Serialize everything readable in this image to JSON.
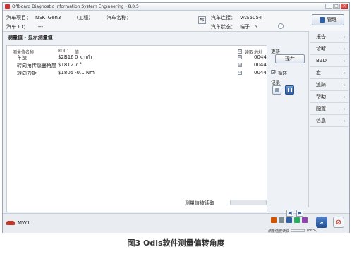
{
  "window": {
    "title": "Offboard Diagnostic Information System Engineering - 8.0.5",
    "controls": [
      "minimize-icon",
      "maximize-icon",
      "close-icon"
    ]
  },
  "info": {
    "project_label": "汽车项目：",
    "project_value": "NSK_Gen3",
    "project_note": "（工程）",
    "vehicle_name_label": "汽车名称：",
    "vehicle_id_label": "汽车 ID：",
    "vehicle_id_value": "---",
    "connection_label": "汽车连接：",
    "connection_value": "VAS5054",
    "state_label": "汽车状态：",
    "state_value": "端子 15",
    "manage_button": "管理"
  },
  "section_title": "测量值 - 显示测量值",
  "table": {
    "columns": [
      "测量值名称",
      "RDID",
      "值",
      "读取",
      "地址"
    ],
    "rows": [
      {
        "name": "车速",
        "rdid": "$2B16",
        "value": "0 km/h",
        "read": "☑",
        "address": "0044"
      },
      {
        "name": "转向角传感器角度",
        "rdid": "$1812",
        "value": "7 °",
        "read": "☑",
        "address": "0044"
      },
      {
        "name": "转向力矩",
        "rdid": "$1805",
        "value": "-0.1 Nm",
        "read": "☑",
        "address": "0044"
      }
    ]
  },
  "side": {
    "update_label": "更新",
    "display_button": "现在",
    "loop_checkbox": "☑",
    "loop_label": "循环",
    "record_label": "记录"
  },
  "nav": {
    "items": [
      "报告",
      "诊断",
      "BZD",
      "宏",
      "追踪",
      "帮助",
      "配置",
      "信息"
    ],
    "arrow": "▸"
  },
  "status": {
    "label": "测量值被读取"
  },
  "bottom": {
    "tab_label": "MW1",
    "voltage_label": "测量值被读取",
    "voltage_value": "(86%)",
    "back_arrow": "◀",
    "fwd_arrow": "▶",
    "next_button": "»",
    "stop_button": "⊘"
  },
  "caption": "图3 Odis软件测量偏转角度",
  "colors": {
    "accent_blue": "#2f5fa0",
    "brand_red": "#c0392b"
  }
}
